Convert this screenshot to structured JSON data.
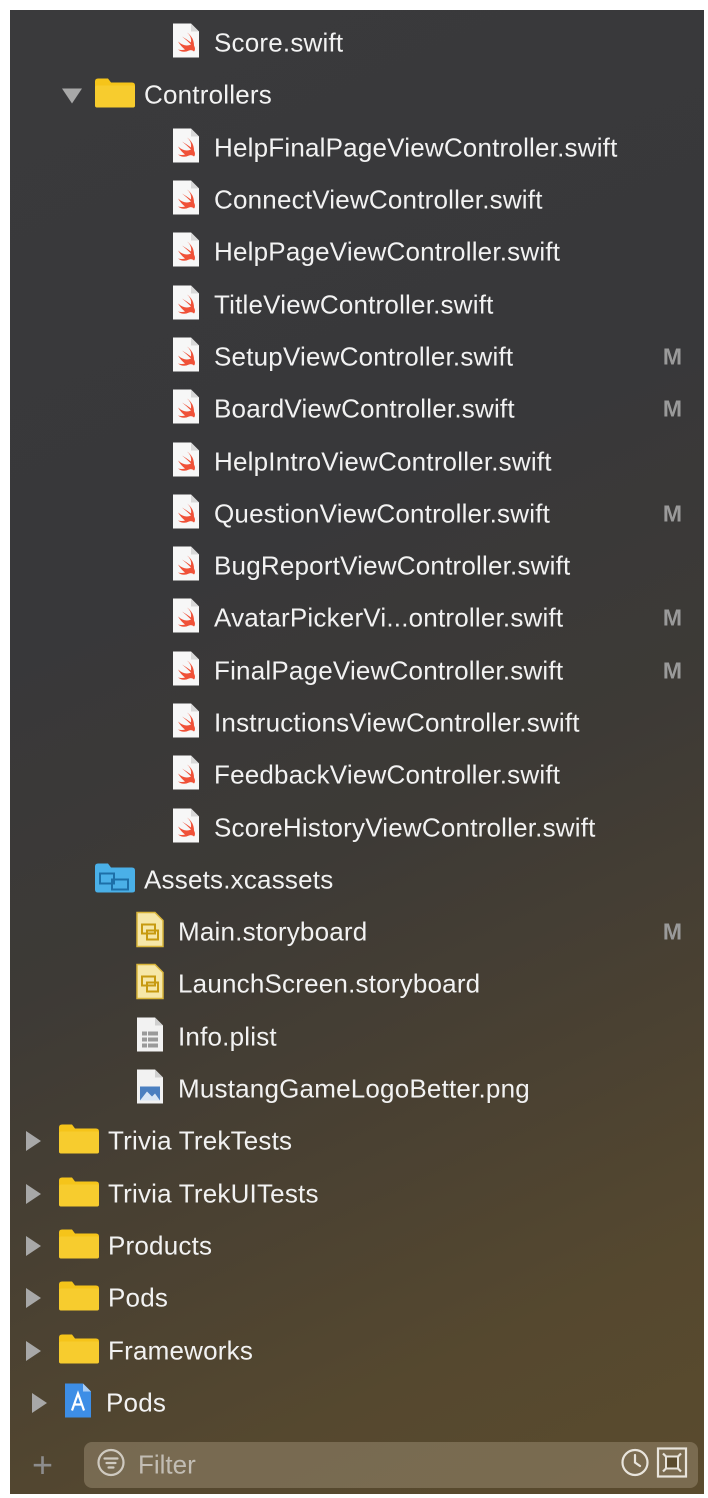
{
  "navigator": {
    "rows": [
      {
        "label": "Score.swift",
        "kind": "swift",
        "indent": 2,
        "badge": ""
      },
      {
        "label": "Controllers",
        "kind": "folder",
        "indent": 1,
        "disclosure": "open",
        "badge": ""
      },
      {
        "label": "HelpFinalPageViewController.swift",
        "kind": "swift",
        "indent": 2,
        "badge": ""
      },
      {
        "label": "ConnectViewController.swift",
        "kind": "swift",
        "indent": 2,
        "badge": ""
      },
      {
        "label": "HelpPageViewController.swift",
        "kind": "swift",
        "indent": 2,
        "badge": ""
      },
      {
        "label": "TitleViewController.swift",
        "kind": "swift",
        "indent": 2,
        "badge": ""
      },
      {
        "label": "SetupViewController.swift",
        "kind": "swift",
        "indent": 2,
        "badge": "M"
      },
      {
        "label": "BoardViewController.swift",
        "kind": "swift",
        "indent": 2,
        "badge": "M"
      },
      {
        "label": "HelpIntroViewController.swift",
        "kind": "swift",
        "indent": 2,
        "badge": ""
      },
      {
        "label": "QuestionViewController.swift",
        "kind": "swift",
        "indent": 2,
        "badge": "M"
      },
      {
        "label": "BugReportViewController.swift",
        "kind": "swift",
        "indent": 2,
        "badge": ""
      },
      {
        "label": "AvatarPickerVi...ontroller.swift",
        "kind": "swift",
        "indent": 2,
        "badge": "M"
      },
      {
        "label": "FinalPageViewController.swift",
        "kind": "swift",
        "indent": 2,
        "badge": "M"
      },
      {
        "label": "InstructionsViewController.swift",
        "kind": "swift",
        "indent": 2,
        "badge": ""
      },
      {
        "label": "FeedbackViewController.swift",
        "kind": "swift",
        "indent": 2,
        "badge": ""
      },
      {
        "label": "ScoreHistoryViewController.swift",
        "kind": "swift",
        "indent": 2,
        "badge": ""
      },
      {
        "label": "Assets.xcassets",
        "kind": "assets",
        "indent": 1,
        "badge": ""
      },
      {
        "label": "Main.storyboard",
        "kind": "storyboard",
        "indent": 1,
        "badge": "M"
      },
      {
        "label": "LaunchScreen.storyboard",
        "kind": "storyboard",
        "indent": 1,
        "badge": ""
      },
      {
        "label": "Info.plist",
        "kind": "plist",
        "indent": 1,
        "badge": ""
      },
      {
        "label": "MustangGameLogoBetter.png",
        "kind": "image",
        "indent": 1,
        "badge": ""
      },
      {
        "label": "Trivia TrekTests",
        "kind": "folder",
        "indent": 0,
        "disclosure": "closed",
        "badge": ""
      },
      {
        "label": "Trivia TrekUITests",
        "kind": "folder",
        "indent": 0,
        "disclosure": "closed",
        "badge": ""
      },
      {
        "label": "Products",
        "kind": "folder",
        "indent": 0,
        "disclosure": "closed",
        "badge": ""
      },
      {
        "label": "Pods",
        "kind": "folder",
        "indent": 0,
        "disclosure": "closed",
        "badge": ""
      },
      {
        "label": "Frameworks",
        "kind": "folder",
        "indent": 0,
        "disclosure": "closed",
        "badge": ""
      },
      {
        "label": "Pods",
        "kind": "project",
        "indent": -1,
        "disclosure": "closed",
        "badge": ""
      }
    ]
  },
  "filter_bar": {
    "add_icon": "plus-icon",
    "filter_icon": "filter-icon",
    "placeholder": "Filter",
    "recent_icon": "clock-icon",
    "scm_icon": "source-control-filter-icon"
  },
  "colors": {
    "folder": "#f5c41a",
    "swift": "#f05138",
    "assets": "#4ab0e8",
    "badge": "#9a9a9a",
    "text": "#f2f2f2"
  }
}
